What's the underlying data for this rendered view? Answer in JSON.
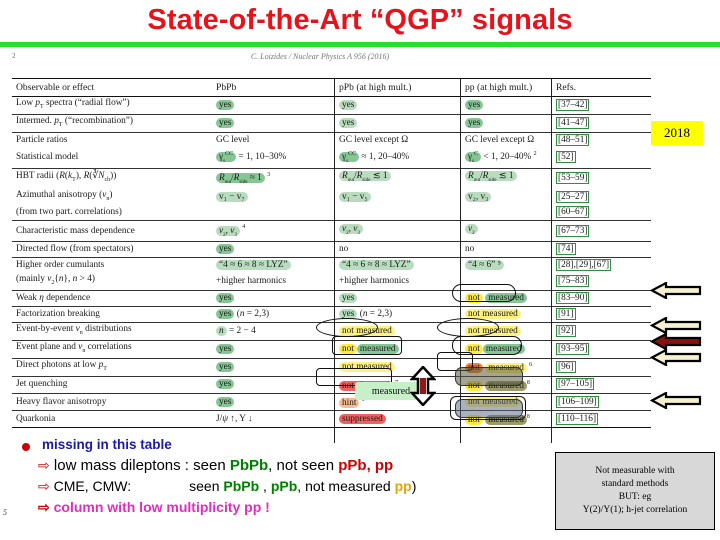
{
  "slide": {
    "title": "State-of-the-Art “QGP” signals",
    "number": "5",
    "rule_color": "#22e32a",
    "title_color": "#e8121a"
  },
  "paper_header": {
    "page_no": "2",
    "citation": "C. Loizides / Nuclear Physics A 956 (2016)"
  },
  "badge": {
    "year": "2018",
    "color": "#ffff00"
  },
  "table": {
    "headers": [
      "Observable or effect",
      "PbPb",
      "pPb (at high mult.)",
      "pp (at high mult.)",
      "Refs."
    ],
    "rows": [
      {
        "observable": "Low p_T spectra (“radial flow”)",
        "pbpb": "yes",
        "ppb": "yes",
        "pp": "yes",
        "refs": "[37–42]"
      },
      {
        "observable": "Intermed. p_T (“recombination”)",
        "pbpb": "yes",
        "ppb": "yes",
        "pp": "yes",
        "refs": "[41–47]"
      },
      {
        "observable": "Particle ratios",
        "pbpb": "GC level",
        "ppb": "GC level except Ω",
        "pp": "GC level except Ω",
        "refs": "[48–51]"
      },
      {
        "observable": "Statistical model",
        "pbpb": "γs^CC = 1, 10–30%",
        "ppb": "γs^CC ≈ 1, 20–40%",
        "pp": "γs^C < 1, 20–40% ²",
        "refs": "[52]"
      },
      {
        "observable": "HBT radii (R(k_T), R(∛N_ch))",
        "pbpb": "R_out/R_side ≈ 1 ³",
        "ppb": "R_out/R_side ≲ 1",
        "pp": "R_out/R_side ≲ 1",
        "refs": "[53–59]"
      },
      {
        "observable": "Azimuthal anisotropy (v_n)",
        "pbpb": "v₁ − v₇",
        "ppb": "v₁ − v₅",
        "pp": "v₂, v₃",
        "refs": "[25–27]"
      },
      {
        "observable": "(from two part. correlations)",
        "pbpb": "",
        "ppb": "",
        "pp": "",
        "refs": "[60–67]"
      },
      {
        "observable": "Characteristic mass dependence",
        "pbpb": "v₂, v₃ ⁴",
        "ppb": "v₂, v₃",
        "pp": "v₂",
        "refs": "[67–73]"
      },
      {
        "observable": "Directed flow (from spectators)",
        "pbpb": "yes",
        "ppb": "no",
        "pp": "no",
        "refs": "[74]"
      },
      {
        "observable": "Higher order cumulants",
        "pbpb": "“4 ≈ 6 ≈ 8 ≈ LYZ”",
        "ppb": "“4 ≈ 6 ≈ 8 ≈ LYZ”",
        "pp": "“4 ≈ 6” ⁵",
        "refs": "[28],[29],[67]"
      },
      {
        "observable": "(mainly v₂{n}, n > 4)",
        "pbpb": "+higher harmonics",
        "ppb": "+higher harmonics",
        "pp": "",
        "refs": "[75–83]"
      },
      {
        "observable": "Weak η dependence",
        "pbpb": "yes",
        "ppb": "yes",
        "pp": "not measured",
        "refs": "[83–90]"
      },
      {
        "observable": "Factorization breaking",
        "pbpb": "yes (n = 2,3)",
        "ppb": "yes (n = 2,3)",
        "pp": "not measured",
        "refs": "[91]"
      },
      {
        "observable": "Event-by-event v_n distributions",
        "pbpb": "n = 2 − 4",
        "ppb": "not measured",
        "pp": "not measured",
        "refs": "[92]"
      },
      {
        "observable": "Event plane and v_n correlations",
        "pbpb": "yes",
        "ppb": "not measured",
        "pp": "not measured",
        "refs": "[93–95]"
      },
      {
        "observable": "Direct photons at low p_T",
        "pbpb": "yes",
        "ppb": "not measured",
        "pp": "not measured ⁶",
        "refs": "[96]"
      },
      {
        "observable": "Jet quenching",
        "pbpb": "yes",
        "ppb": "not observed ⁷",
        "pp": "not measured ⁸",
        "refs": "[97–105]"
      },
      {
        "observable": "Heavy flavor anisotropy",
        "pbpb": "yes",
        "ppb": "hint ⁹",
        "pp": "not measured",
        "refs": "[106–109]"
      },
      {
        "observable": "Quarkonia",
        "pbpb": "J/ψ ↑, Υ ↓",
        "ppb": "suppressed",
        "pp": "not measured ⁸",
        "refs": "[110–116]"
      }
    ]
  },
  "overlays": {
    "measured_sticker": "measured",
    "arrow_updown": "up-down-arrow",
    "left_arrows_count": 4
  },
  "bullets": {
    "b0": "missing in this table",
    "b1": {
      "pre": "low mass dileptons : seen ",
      "pbpb": "PbPb",
      "mid": ", not seen ",
      "ppb": "pPb, pp"
    },
    "b2": {
      "pre": "CME, CMW:",
      "seen": "seen ",
      "pbpb": "PbPb",
      "comma": " , ",
      "ppb": "pPb",
      "mid": ", not measured ",
      "pp": "pp",
      "end": ")"
    },
    "b3": "column with low multiplicity pp !",
    "marker": "⇨"
  },
  "note_box": {
    "lines": [
      "Not measurable with",
      "standard methods",
      "BUT: eg",
      "Y(2)/Y(1); h-jet correlation"
    ],
    "bg": "#d8d8d8"
  }
}
